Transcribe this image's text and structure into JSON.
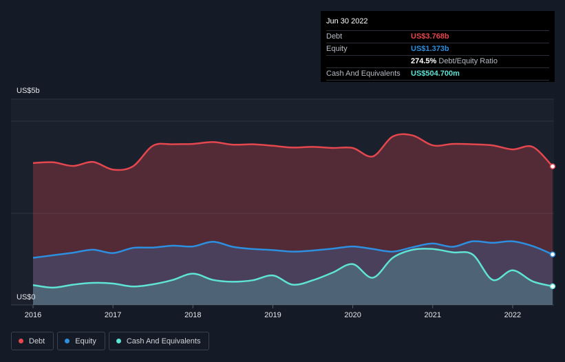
{
  "tooltip": {
    "date": "Jun 30 2022",
    "rows": [
      {
        "label": "Debt",
        "value": "US$3.768b",
        "color": "#e5474f"
      },
      {
        "label": "Equity",
        "value": "US$1.373b",
        "color": "#2d8fe0"
      },
      {
        "label": "",
        "value": "274.5%",
        "suffix": "Debt/Equity Ratio"
      },
      {
        "label": "Cash And Equivalents",
        "value": "US$504.700m",
        "color": "#5fe3d4"
      }
    ]
  },
  "legend": [
    {
      "label": "Debt",
      "color": "#e5474f"
    },
    {
      "label": "Equity",
      "color": "#2d8fe0"
    },
    {
      "label": "Cash And Equivalents",
      "color": "#5fe3d4"
    }
  ],
  "chart_data": {
    "type": "area",
    "y_top_label": "US$5b",
    "y_bottom_label": "US$0",
    "ylim": [
      0,
      5
    ],
    "xlim": [
      2016,
      2022.5
    ],
    "x_ticks": [
      "2016",
      "2017",
      "2018",
      "2019",
      "2020",
      "2021",
      "2022"
    ],
    "x_tick_values": [
      2016,
      2017,
      2018,
      2019,
      2020,
      2021,
      2022
    ],
    "grid": true,
    "series": [
      {
        "name": "Debt",
        "color": "#e5474f",
        "x": [
          2016.0,
          2016.25,
          2016.5,
          2016.75,
          2017.0,
          2017.25,
          2017.5,
          2017.75,
          2018.0,
          2018.25,
          2018.5,
          2018.75,
          2019.0,
          2019.25,
          2019.5,
          2019.75,
          2020.0,
          2020.25,
          2020.5,
          2020.75,
          2021.0,
          2021.25,
          2021.5,
          2021.75,
          2022.0,
          2022.25,
          2022.5
        ],
        "values": [
          3.86,
          3.88,
          3.78,
          3.89,
          3.68,
          3.77,
          4.33,
          4.37,
          4.38,
          4.43,
          4.36,
          4.37,
          4.33,
          4.28,
          4.3,
          4.27,
          4.27,
          4.04,
          4.58,
          4.61,
          4.34,
          4.38,
          4.37,
          4.34,
          4.23,
          4.3,
          3.768
        ]
      },
      {
        "name": "Equity",
        "color": "#2d8fe0",
        "x": [
          2016.0,
          2016.25,
          2016.5,
          2016.75,
          2017.0,
          2017.25,
          2017.5,
          2017.75,
          2018.0,
          2018.25,
          2018.5,
          2018.75,
          2019.0,
          2019.25,
          2019.5,
          2019.75,
          2020.0,
          2020.25,
          2020.5,
          2020.75,
          2021.0,
          2021.25,
          2021.5,
          2021.75,
          2022.0,
          2022.25,
          2022.5
        ],
        "values": [
          1.28,
          1.35,
          1.42,
          1.5,
          1.41,
          1.55,
          1.56,
          1.61,
          1.59,
          1.72,
          1.58,
          1.52,
          1.49,
          1.45,
          1.48,
          1.53,
          1.59,
          1.52,
          1.45,
          1.57,
          1.67,
          1.58,
          1.73,
          1.69,
          1.73,
          1.6,
          1.373
        ]
      },
      {
        "name": "Cash And Equivalents",
        "color": "#5fe3d4",
        "x": [
          2016.0,
          2016.25,
          2016.5,
          2016.75,
          2017.0,
          2017.25,
          2017.5,
          2017.75,
          2018.0,
          2018.25,
          2018.5,
          2018.75,
          2019.0,
          2019.25,
          2019.5,
          2019.75,
          2020.0,
          2020.25,
          2020.5,
          2020.75,
          2021.0,
          2021.25,
          2021.5,
          2021.75,
          2022.0,
          2022.25,
          2022.5
        ],
        "values": [
          0.54,
          0.47,
          0.55,
          0.6,
          0.58,
          0.5,
          0.56,
          0.68,
          0.85,
          0.68,
          0.63,
          0.67,
          0.8,
          0.55,
          0.67,
          0.88,
          1.11,
          0.74,
          1.28,
          1.5,
          1.52,
          1.43,
          1.37,
          0.68,
          0.94,
          0.64,
          0.5047
        ]
      }
    ]
  }
}
